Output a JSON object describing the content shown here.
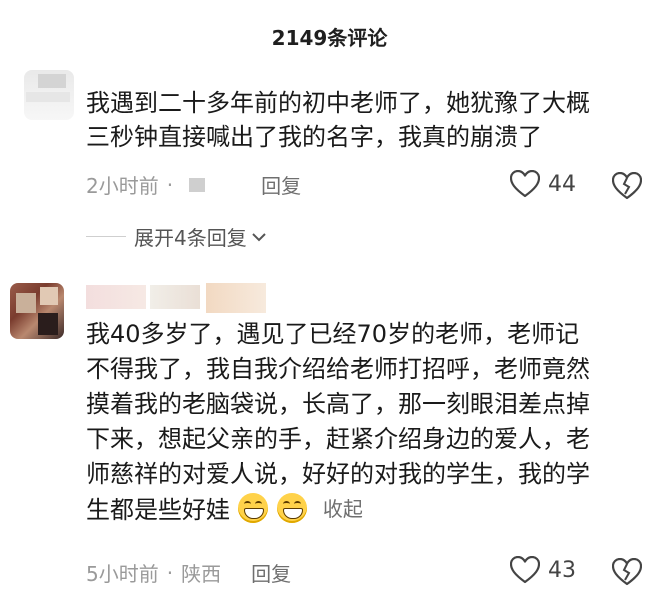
{
  "header": {
    "title": "2149条评论"
  },
  "comments": [
    {
      "text_line1": "我遇到二十多年前的初中老师了，她犹豫了大概",
      "text_line2": "三秒钟直接喊出了我的名字，我真的崩溃了",
      "time": "2小时前",
      "reply_label": "回复",
      "likes": "44",
      "expand_label": "展开4条回复"
    },
    {
      "lines": [
        "我40多岁了，遇见了已经70岁的老师，老师记",
        "不得我了，我自我介绍给老师打招呼，老师竟然",
        "摸着我的老脑袋说，长高了，那一刻眼泪差点掉",
        "下来，想起父亲的手，赶紧介绍身边的爱人，老",
        "师慈祥的对爱人说，好好的对我的学生，我的学",
        "生都是些好娃"
      ],
      "collapse_label": "收起",
      "time": "5小时前",
      "location": "陕西",
      "reply_label": "回复",
      "likes": "43"
    }
  ],
  "icons": {
    "heart": "heart-icon",
    "broken_heart": "broken-heart-icon",
    "chevron": "chevron-down-icon",
    "emoji": "grin-emoji-icon"
  },
  "colors": {
    "meta": "#9a9a9a",
    "text": "#1a1a1a",
    "emoji": "#ffd24a"
  }
}
